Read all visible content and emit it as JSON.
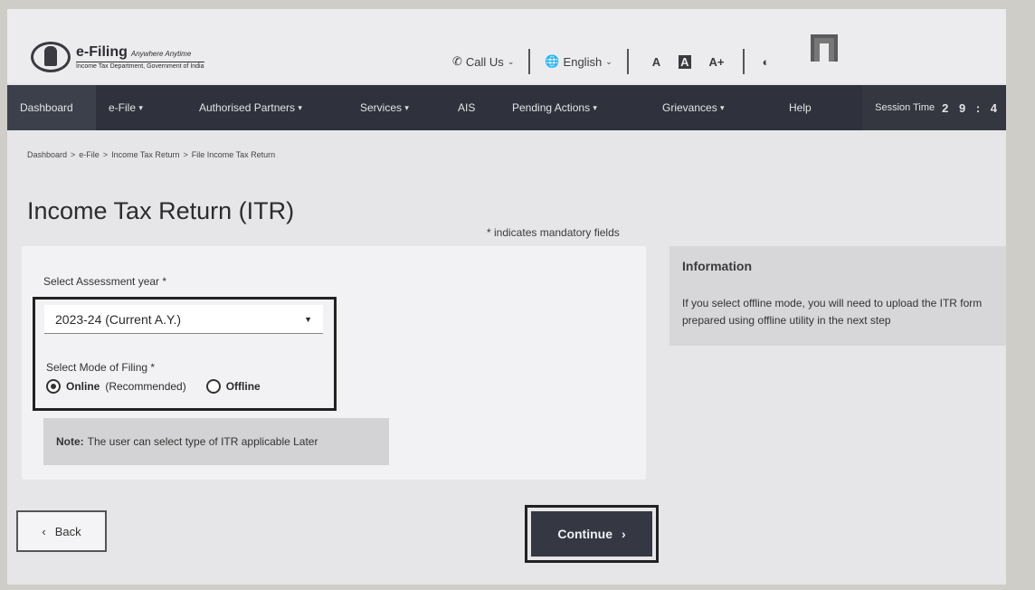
{
  "header": {
    "logo_title": "e-Filing",
    "logo_tagline": "Anywhere Anytime",
    "logo_subtitle": "Income Tax Department, Government of India",
    "call_us": "Call Us",
    "language": "English",
    "font_decrease": "A",
    "font_reset": "A",
    "font_increase": "A+"
  },
  "nav": {
    "items": [
      {
        "label": "Dashboard"
      },
      {
        "label": "e-File"
      },
      {
        "label": "Authorised Partners"
      },
      {
        "label": "Services"
      },
      {
        "label": "AIS"
      },
      {
        "label": "Pending Actions"
      },
      {
        "label": "Grievances"
      },
      {
        "label": "Help"
      }
    ],
    "session_label": "Session Time",
    "session_value": "2 9 : 4"
  },
  "breadcrumb": [
    "Dashboard",
    "e-File",
    "Income Tax Return",
    "File Income Tax Return"
  ],
  "page_title": "Income Tax Return (ITR)",
  "mandatory_note": "* indicates mandatory fields",
  "form": {
    "assessment_label": "Select Assessment year *",
    "assessment_value": "2023-24 (Current A.Y.)",
    "mode_label": "Select Mode of Filing *",
    "mode_online_main": "Online",
    "mode_online_sub": "(Recommended)",
    "mode_offline": "Offline",
    "selected_mode": "Online",
    "note_label": "Note:",
    "note_text": "The user can select type of ITR applicable Later"
  },
  "info": {
    "title": "Information",
    "text": "If you select offline mode, you will need to upload the ITR form prepared using offline utility in the next step"
  },
  "buttons": {
    "back": "Back",
    "continue": "Continue"
  },
  "icons": {
    "call": "phone-icon",
    "language": "globe-icon",
    "contrast": "contrast-icon",
    "user": "user-icon"
  }
}
